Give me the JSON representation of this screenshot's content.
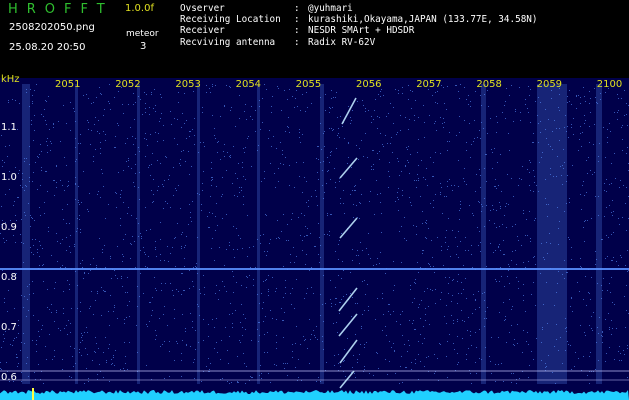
{
  "header": {
    "app_title": "HROFFT",
    "version": "1.0.0f",
    "filename": "2508202050.png",
    "datetime": "25.08.20 20:50",
    "counter_label": "meteor",
    "counter_value": "3",
    "info": [
      {
        "label": "Ovserver",
        "value": "@yuhmari"
      },
      {
        "label": "Receiving Location",
        "value": "kurashiki,Okayama,JAPAN (133.77E, 34.58N)"
      },
      {
        "label": "Receiver",
        "value": "NESDR SMArt + HDSDR"
      },
      {
        "label": "Recviving antenna",
        "value": "Radix RV-62V"
      }
    ]
  },
  "spectrogram": {
    "y_unit": "kHz",
    "y_ticks": [
      "1.1",
      "1.0",
      "0.9",
      "0.8",
      "0.7",
      "0.6"
    ],
    "x_ticks": [
      "2051",
      "2052",
      "2053",
      "2054",
      "2055",
      "2056",
      "2057",
      "2058",
      "2059",
      "2100"
    ],
    "echoes": 3
  },
  "colors": {
    "title": "#2fbf2f",
    "version": "#e0e020",
    "header_text": "#ffffff",
    "tick_text": "#e0e020",
    "background": "#00004a",
    "signal": "#5a90ff",
    "noise_floor": "#20d0ff"
  }
}
